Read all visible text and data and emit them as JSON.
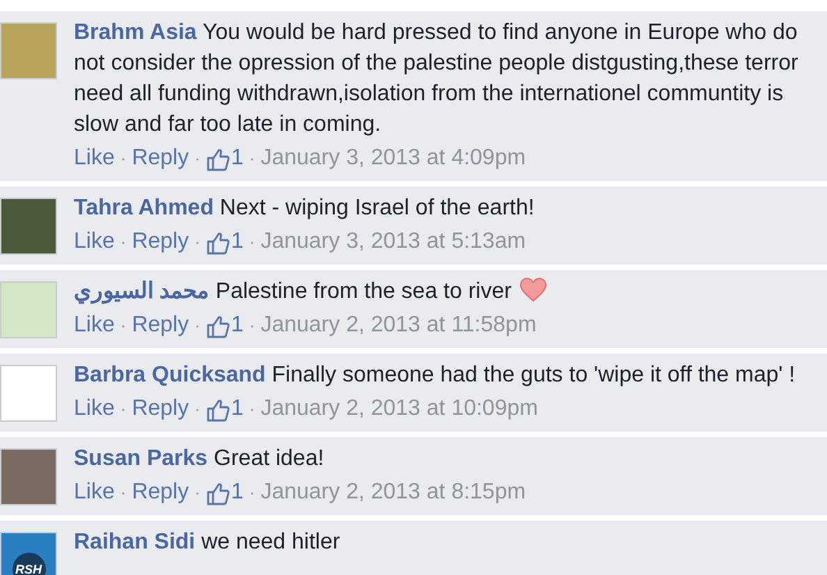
{
  "comments": [
    {
      "author": "Brahm Asia",
      "lines": [
        "You would be hard pressed to find anyone in Europe who do",
        "not consider the opression of the palestine people distgusting,these terror",
        "need all funding withdrawn,isolation from the internationel communtity is",
        "slow and far too late in coming."
      ],
      "heart": false,
      "like": "Like",
      "separator": "·",
      "reply": "Reply",
      "like_count": "1",
      "time": "January 3, 2013 at 4:09pm"
    },
    {
      "author": "Tahra Ahmed",
      "lines": [
        "Next - wiping Israel of the earth!"
      ],
      "heart": false,
      "like": "Like",
      "separator": "·",
      "reply": "Reply",
      "like_count": "1",
      "time": "January 3, 2013 at 5:13am"
    },
    {
      "author": "محمد السيوري",
      "lines": [
        "Palestine from the sea to river"
      ],
      "heart": true,
      "like": "Like",
      "separator": "·",
      "reply": "Reply",
      "like_count": "1",
      "time": "January 2, 2013 at 11:58pm"
    },
    {
      "author": "Barbra Quicksand",
      "lines": [
        "Finally someone had the guts to 'wipe it off the map' !"
      ],
      "heart": false,
      "like": "Like",
      "separator": "·",
      "reply": "Reply",
      "like_count": "1",
      "time": "January 2, 2013 at 10:09pm"
    },
    {
      "author": "Susan Parks",
      "lines": [
        "Great idea!"
      ],
      "heart": false,
      "like": "Like",
      "separator": "·",
      "reply": "Reply",
      "like_count": "1",
      "time": "January 2, 2013 at 8:15pm"
    },
    {
      "author": "Raihan Sidi",
      "avatar_text": "RSH",
      "lines": [
        "we need hitler"
      ],
      "heart": false
    }
  ]
}
